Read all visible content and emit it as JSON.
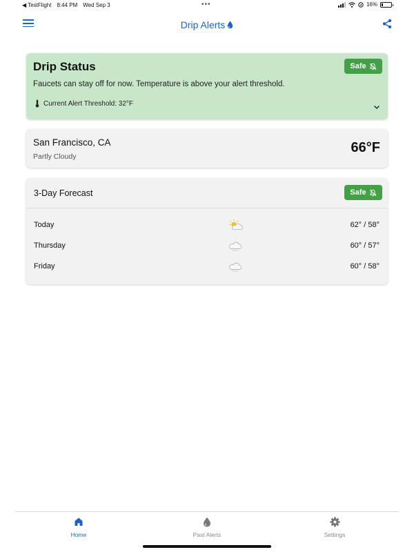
{
  "status_bar": {
    "back_app": "◀ TestFlight",
    "time": "8:44 PM",
    "date": "Wed Sep 3",
    "battery": "16%"
  },
  "nav": {
    "title": "Drip Alerts",
    "menu_icon": "hamburger-menu-icon",
    "share_icon": "share-icon"
  },
  "drip_status": {
    "title": "Drip Status",
    "message": "Faucets can stay off for now. Temperature is above your alert threshold.",
    "threshold_label": "Current Alert Threshold: 32°F",
    "badge": "Safe",
    "badge_color": "#43a047",
    "card_color": "#c8e6c9"
  },
  "location": {
    "name": "San Francisco, CA",
    "condition": "Partly Cloudy",
    "temperature": "66°F"
  },
  "forecast": {
    "title": "3-Day Forecast",
    "badge": "Safe",
    "days": [
      {
        "day": "Today",
        "icon": "partly-cloudy-icon",
        "temps": "62° / 58°"
      },
      {
        "day": "Thursday",
        "icon": "cloud-icon",
        "temps": "60° / 57°"
      },
      {
        "day": "Friday",
        "icon": "cloud-icon",
        "temps": "60° / 58°"
      }
    ]
  },
  "tabs": [
    {
      "label": "Home",
      "icon": "home-icon",
      "active": true
    },
    {
      "label": "Past Alerts",
      "icon": "droplet-icon",
      "active": false
    },
    {
      "label": "Settings",
      "icon": "gear-icon",
      "active": false
    }
  ],
  "colors": {
    "accent": "#1b63c4",
    "safe": "#43a047"
  }
}
